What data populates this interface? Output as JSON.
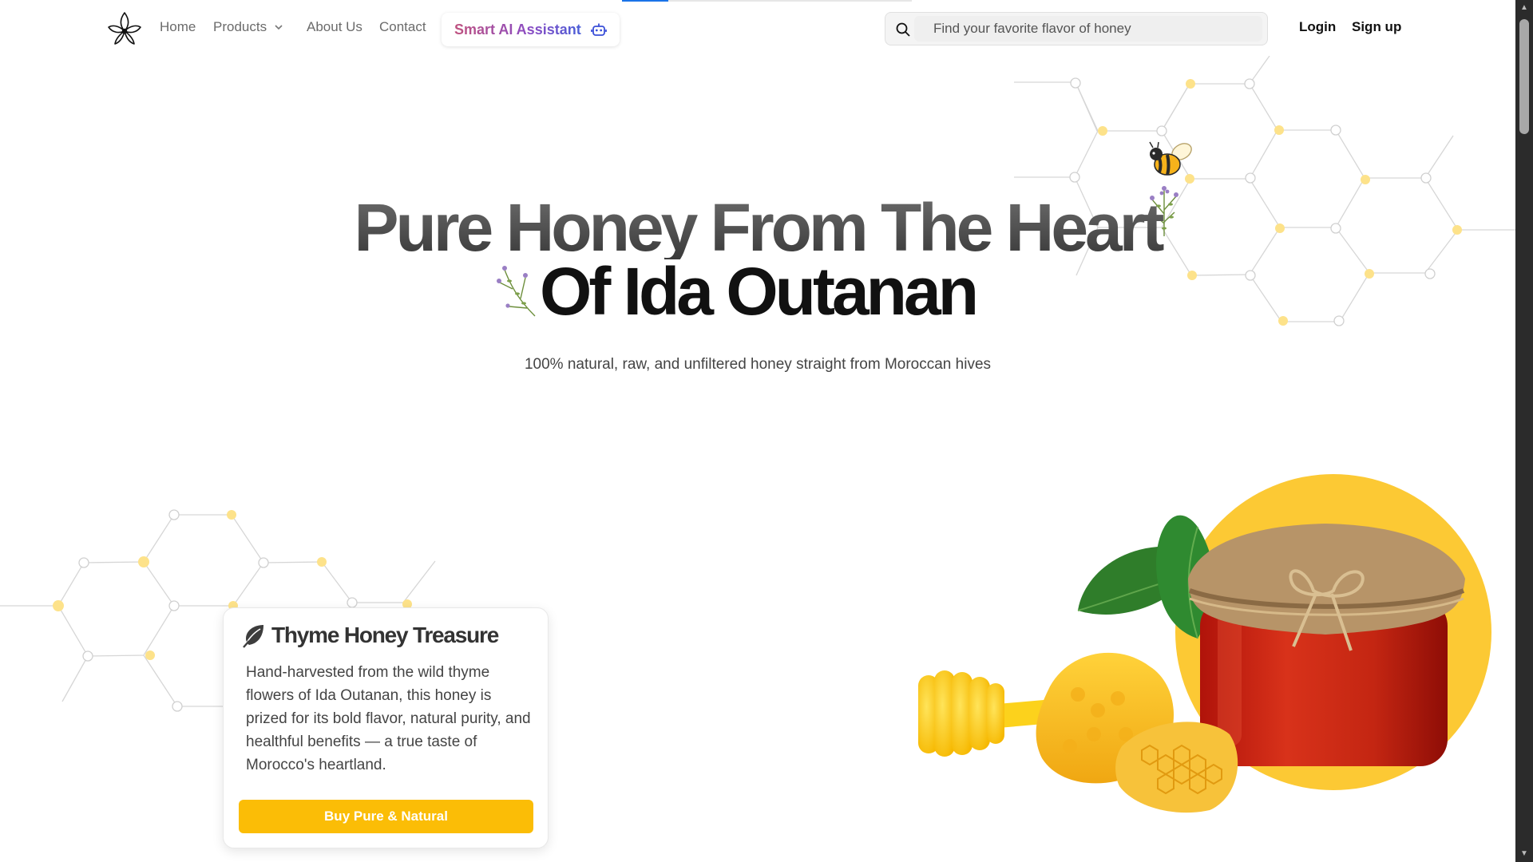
{
  "nav": {
    "links": [
      {
        "label": "Home"
      },
      {
        "label": "Products"
      },
      {
        "label": "About Us"
      },
      {
        "label": "Contact"
      }
    ],
    "ai_assistant_label": "Smart AI Assistant",
    "search_placeholder": "Find your favorite flavor of honey",
    "login_label": "Login",
    "signup_label": "Sign up"
  },
  "hero": {
    "title_line1": "Pure Honey From The Heart",
    "title_line2": "Of Ida Outanan",
    "subtitle": "100% natural, raw, and unfiltered honey straight from Moroccan hives"
  },
  "product_card": {
    "title": "Thyme Honey Treasure",
    "description": "Hand-harvested from the wild thyme flowers of Ida Outanan, this honey is prized for its bold flavor, natural purity, and healthful benefits — a true taste of Morocco's heartland.",
    "button_label": "Buy Pure & Natural"
  },
  "icons": [
    "logo-icon",
    "chevron-down-icon",
    "robot-icon",
    "search-icon",
    "leaf-icon",
    "bee-icon",
    "thyme-sprig-icon",
    "honey-jar-image"
  ],
  "colors": {
    "accent_yellow": "#fbbd06",
    "honey_circle": "#fcc934",
    "ai_gradient_start": "#c0527f",
    "ai_gradient_end": "#4a5fd8",
    "hex_node_filled": "#fde28a"
  },
  "page_load_progress": 0.16
}
